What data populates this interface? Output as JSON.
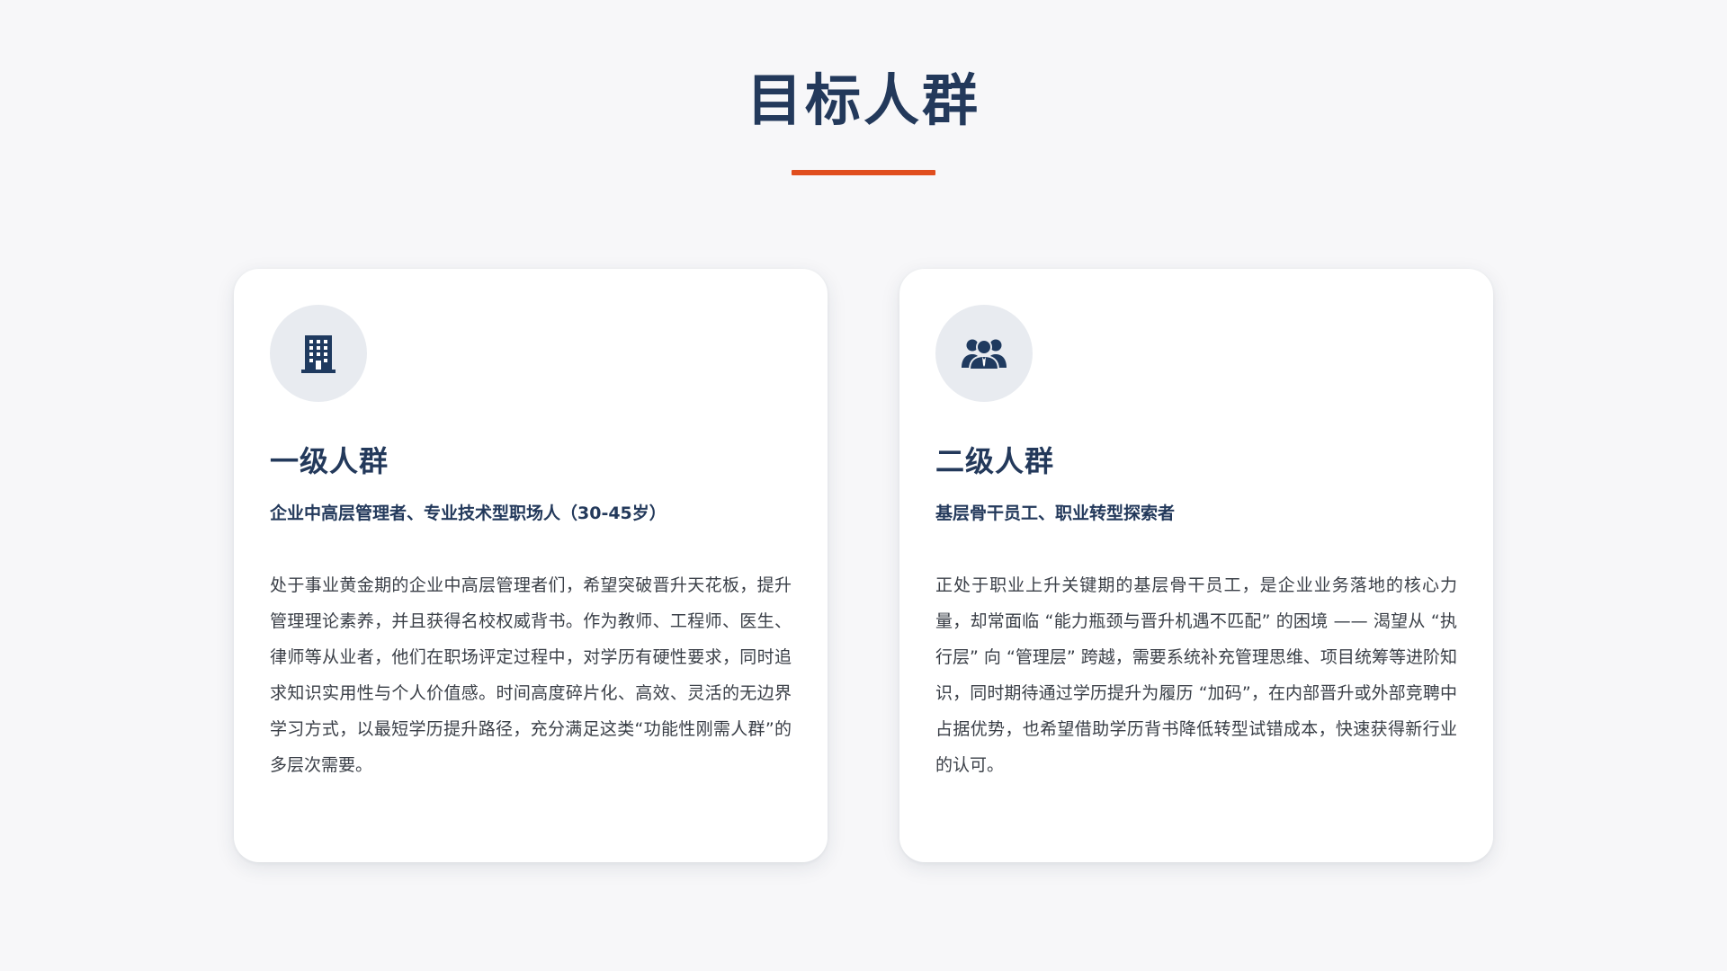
{
  "page": {
    "title": "目标人群"
  },
  "colors": {
    "title": "#23395b",
    "accent_underline": "#e04e1f",
    "icon_fill": "#1f3a5f",
    "icon_circle_bg": "#e8ebf0",
    "card_bg": "#ffffff",
    "page_bg": "#f7f7f9",
    "body_text": "#3a3f47"
  },
  "cards": [
    {
      "icon": "building-icon",
      "title": "一级人群",
      "subtitle": "企业中高层管理者、专业技术型职场人（30-45岁）",
      "body": "处于事业黄金期的企业中高层管理者们，希望突破晋升天花板，提升管理理论素养，并且获得名校权威背书。作为教师、工程师、医生、律师等从业者，他们在职场评定过程中，对学历有硬性要求，同时追求知识实用性与个人价值感。时间高度碎片化、高效、灵活的无边界学习方式，以最短学历提升路径，充分满足这类“功能性刚需人群”的多层次需要。"
    },
    {
      "icon": "user-group-icon",
      "title": "二级人群",
      "subtitle": "基层骨干员工、职业转型探索者",
      "body": "正处于职业上升关键期的基层骨干员工，是企业业务落地的核心力量，却常面临 “能力瓶颈与晋升机遇不匹配” 的困境 —— 渴望从 “执行层” 向 “管理层” 跨越，需要系统补充管理思维、项目统筹等进阶知识，同时期待通过学历提升为履历 “加码”，在内部晋升或外部竞聘中占据优势，也希望借助学历背书降低转型试错成本，快速获得新行业的认可。"
    }
  ]
}
